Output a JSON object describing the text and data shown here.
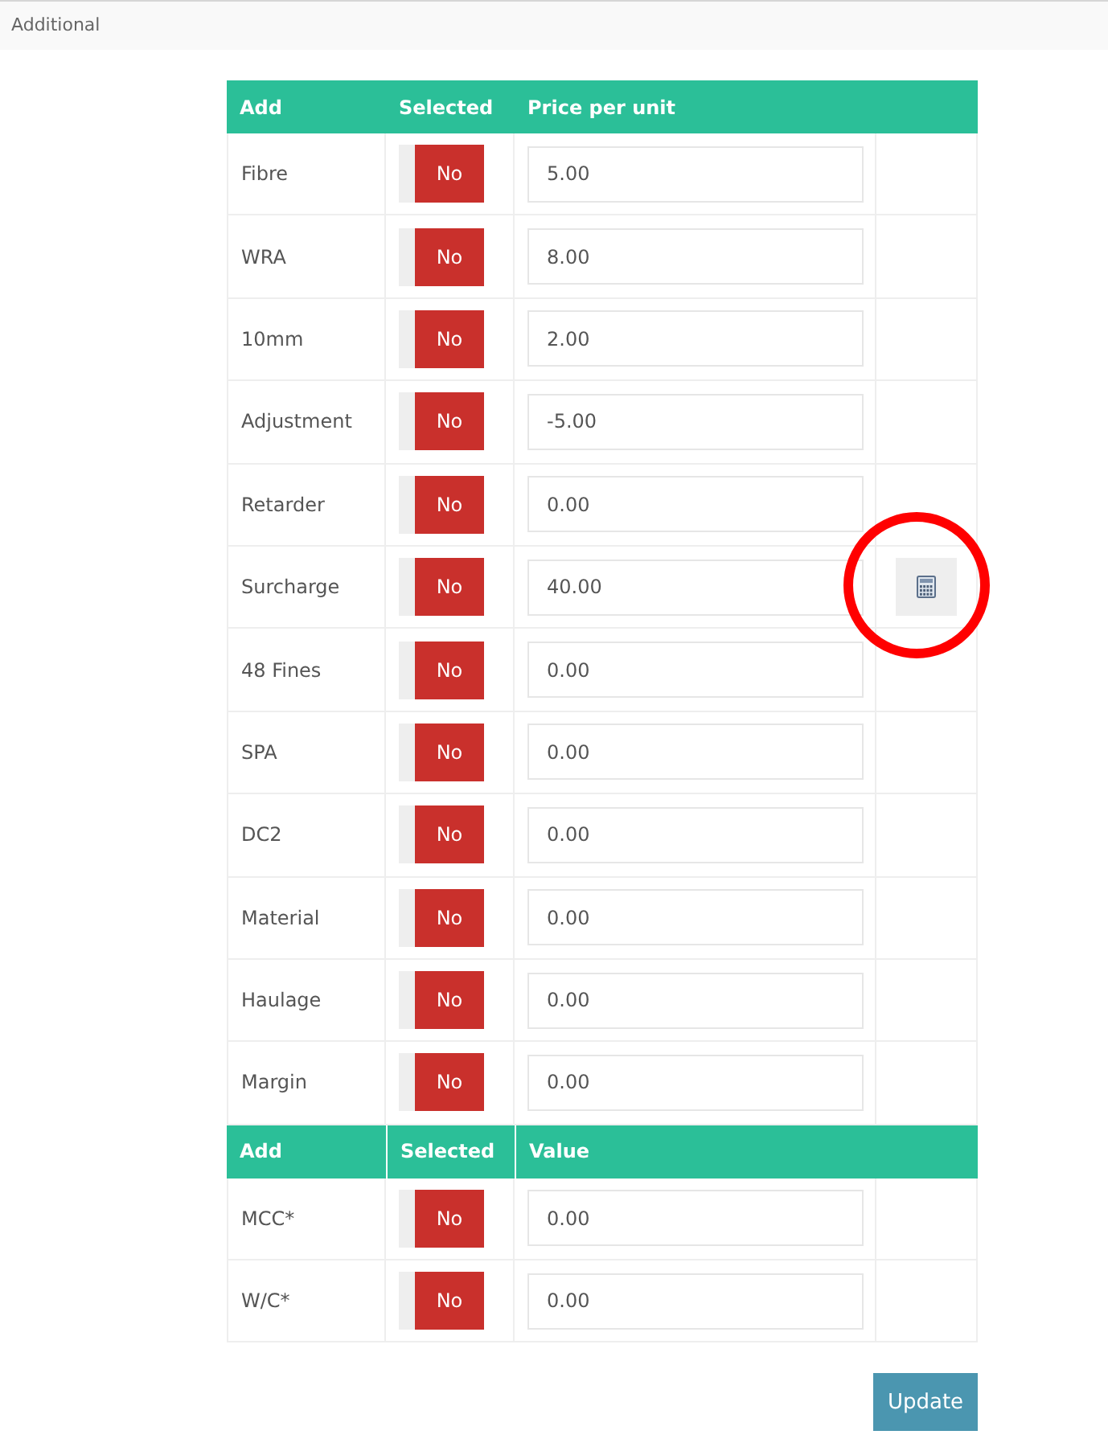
{
  "header": {
    "title": "Additional"
  },
  "sections": [
    {
      "dividers": false,
      "columns": [
        "Add",
        "Selected",
        "Price per unit"
      ],
      "rows": [
        {
          "name": "Fibre",
          "toggle_label": "No",
          "on": false,
          "value": "5.00",
          "calculator": false,
          "circled": false
        },
        {
          "name": "WRA",
          "toggle_label": "No",
          "on": false,
          "value": "8.00",
          "calculator": false,
          "circled": false
        },
        {
          "name": "10mm",
          "toggle_label": "No",
          "on": false,
          "value": "2.00",
          "calculator": false,
          "circled": false
        },
        {
          "name": "Adjustment",
          "toggle_label": "No",
          "on": false,
          "value": "-5.00",
          "calculator": false,
          "circled": false
        },
        {
          "name": "Retarder",
          "toggle_label": "No",
          "on": false,
          "value": "0.00",
          "calculator": false,
          "circled": false
        },
        {
          "name": "Surcharge",
          "toggle_label": "No",
          "on": false,
          "value": "40.00",
          "calculator": true,
          "circled": true
        },
        {
          "name": "48 Fines",
          "toggle_label": "No",
          "on": false,
          "value": "0.00",
          "calculator": false,
          "circled": false
        },
        {
          "name": "SPA",
          "toggle_label": "No",
          "on": false,
          "value": "0.00",
          "calculator": false,
          "circled": false
        },
        {
          "name": "DC2",
          "toggle_label": "No",
          "on": false,
          "value": "0.00",
          "calculator": false,
          "circled": false
        },
        {
          "name": "Material",
          "toggle_label": "No",
          "on": false,
          "value": "0.00",
          "calculator": false,
          "circled": false
        },
        {
          "name": "Haulage",
          "toggle_label": "No",
          "on": false,
          "value": "0.00",
          "calculator": false,
          "circled": false
        },
        {
          "name": "Margin",
          "toggle_label": "No",
          "on": false,
          "value": "0.00",
          "calculator": false,
          "circled": false
        }
      ]
    },
    {
      "dividers": true,
      "columns": [
        "Add",
        "Selected",
        "Value"
      ],
      "rows": [
        {
          "name": "MCC*",
          "toggle_label": "No",
          "on": false,
          "value": "0.00",
          "calculator": false,
          "circled": false
        },
        {
          "name": "W/C*",
          "toggle_label": "No",
          "on": false,
          "value": "0.00",
          "calculator": false,
          "circled": false
        }
      ]
    }
  ],
  "update_button": {
    "label": "Update"
  }
}
